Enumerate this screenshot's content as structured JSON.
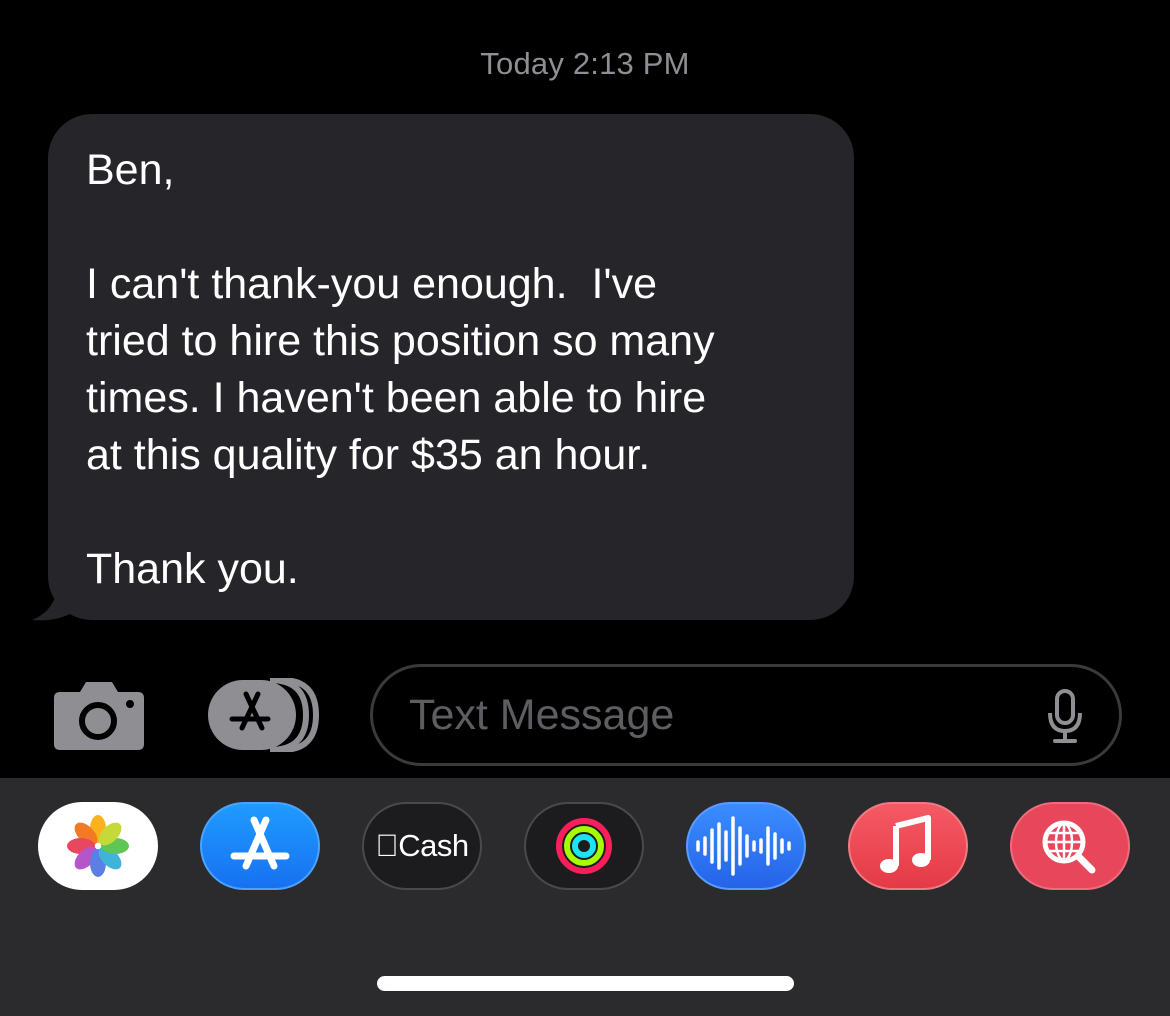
{
  "conversation": {
    "timestamp": "Today 2:13 PM",
    "message": {
      "direction": "incoming",
      "lines": [
        "Ben,",
        "",
        "I can't thank-you enough.  I've",
        "tried to hire this position so many",
        "times. I haven't been able to hire",
        "at this quality for $35 an hour.",
        "",
        "Thank you."
      ]
    }
  },
  "composer": {
    "camera_icon": "camera-icon",
    "apps_icon": "app-store-icon",
    "placeholder": "Text Message",
    "value": "",
    "mic_icon": "microphone-icon"
  },
  "app_tray": {
    "apps": [
      {
        "id": "photos",
        "icon": "photos-icon"
      },
      {
        "id": "app-store",
        "icon": "app-store-icon"
      },
      {
        "id": "apple-cash",
        "label": "Cash",
        "icon": "apple-logo-icon"
      },
      {
        "id": "fitness",
        "icon": "activity-rings-icon"
      },
      {
        "id": "audio-message",
        "icon": "waveform-icon"
      },
      {
        "id": "music",
        "icon": "music-note-icon"
      },
      {
        "id": "images-search",
        "icon": "globe-search-icon"
      }
    ]
  },
  "colors": {
    "background": "#000000",
    "bubble": "#26252a",
    "tray": "#2b2b2d",
    "timestamp": "#8e8e93"
  }
}
